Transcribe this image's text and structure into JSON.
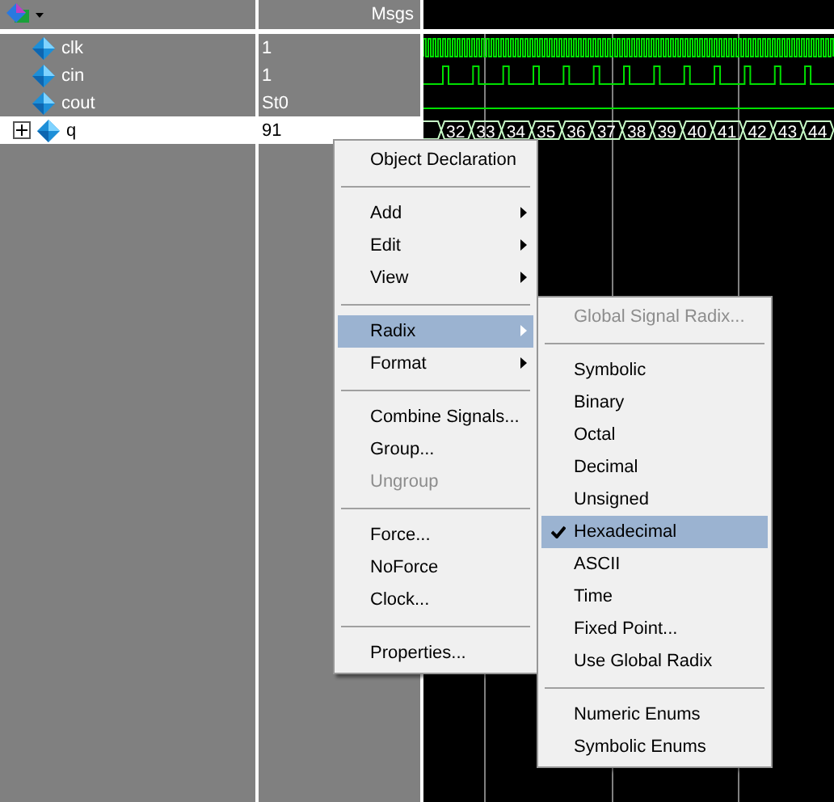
{
  "header": {
    "value_column": "Msgs"
  },
  "signals": [
    {
      "name": "clk",
      "value": "1",
      "kind": "clock",
      "selected": false,
      "expandable": false
    },
    {
      "name": "cin",
      "value": "1",
      "kind": "pulse",
      "selected": false,
      "expandable": false
    },
    {
      "name": "cout",
      "value": "St0",
      "kind": "low",
      "selected": false,
      "expandable": false
    },
    {
      "name": "q",
      "value": "91",
      "kind": "bus",
      "selected": true,
      "expandable": true,
      "bus_values": [
        "32",
        "33",
        "34",
        "35",
        "36",
        "37",
        "38",
        "39",
        "40",
        "41",
        "42",
        "43",
        "44"
      ]
    }
  ],
  "context_menu": {
    "groups": [
      [
        {
          "label": "Object Declaration",
          "submenu": false,
          "disabled": false,
          "selected": false
        }
      ],
      [
        {
          "label": "Add",
          "submenu": true,
          "disabled": false,
          "selected": false
        },
        {
          "label": "Edit",
          "submenu": true,
          "disabled": false,
          "selected": false
        },
        {
          "label": "View",
          "submenu": true,
          "disabled": false,
          "selected": false
        }
      ],
      [
        {
          "label": "Radix",
          "submenu": true,
          "disabled": false,
          "selected": true
        },
        {
          "label": "Format",
          "submenu": true,
          "disabled": false,
          "selected": false
        }
      ],
      [
        {
          "label": "Combine Signals...",
          "submenu": false,
          "disabled": false,
          "selected": false
        },
        {
          "label": "Group...",
          "submenu": false,
          "disabled": false,
          "selected": false
        },
        {
          "label": "Ungroup",
          "submenu": false,
          "disabled": true,
          "selected": false
        }
      ],
      [
        {
          "label": "Force...",
          "submenu": false,
          "disabled": false,
          "selected": false
        },
        {
          "label": "NoForce",
          "submenu": false,
          "disabled": false,
          "selected": false
        },
        {
          "label": "Clock...",
          "submenu": false,
          "disabled": false,
          "selected": false
        }
      ],
      [
        {
          "label": "Properties...",
          "submenu": false,
          "disabled": false,
          "selected": false
        }
      ]
    ]
  },
  "radix_submenu": {
    "groups": [
      [
        {
          "label": "Global Signal Radix...",
          "disabled": true,
          "checked": false
        }
      ],
      [
        {
          "label": "Symbolic",
          "disabled": false,
          "checked": false
        },
        {
          "label": "Binary",
          "disabled": false,
          "checked": false
        },
        {
          "label": "Octal",
          "disabled": false,
          "checked": false
        },
        {
          "label": "Decimal",
          "disabled": false,
          "checked": false
        },
        {
          "label": "Unsigned",
          "disabled": false,
          "checked": false
        },
        {
          "label": "Hexadecimal",
          "disabled": false,
          "checked": true
        },
        {
          "label": "ASCII",
          "disabled": false,
          "checked": false
        },
        {
          "label": "Time",
          "disabled": false,
          "checked": false
        },
        {
          "label": "Fixed Point...",
          "disabled": false,
          "checked": false
        },
        {
          "label": "Use Global Radix",
          "disabled": false,
          "checked": false
        }
      ],
      [
        {
          "label": "Numeric Enums",
          "disabled": false,
          "checked": false
        },
        {
          "label": "Symbolic Enums",
          "disabled": false,
          "checked": false
        }
      ]
    ]
  }
}
